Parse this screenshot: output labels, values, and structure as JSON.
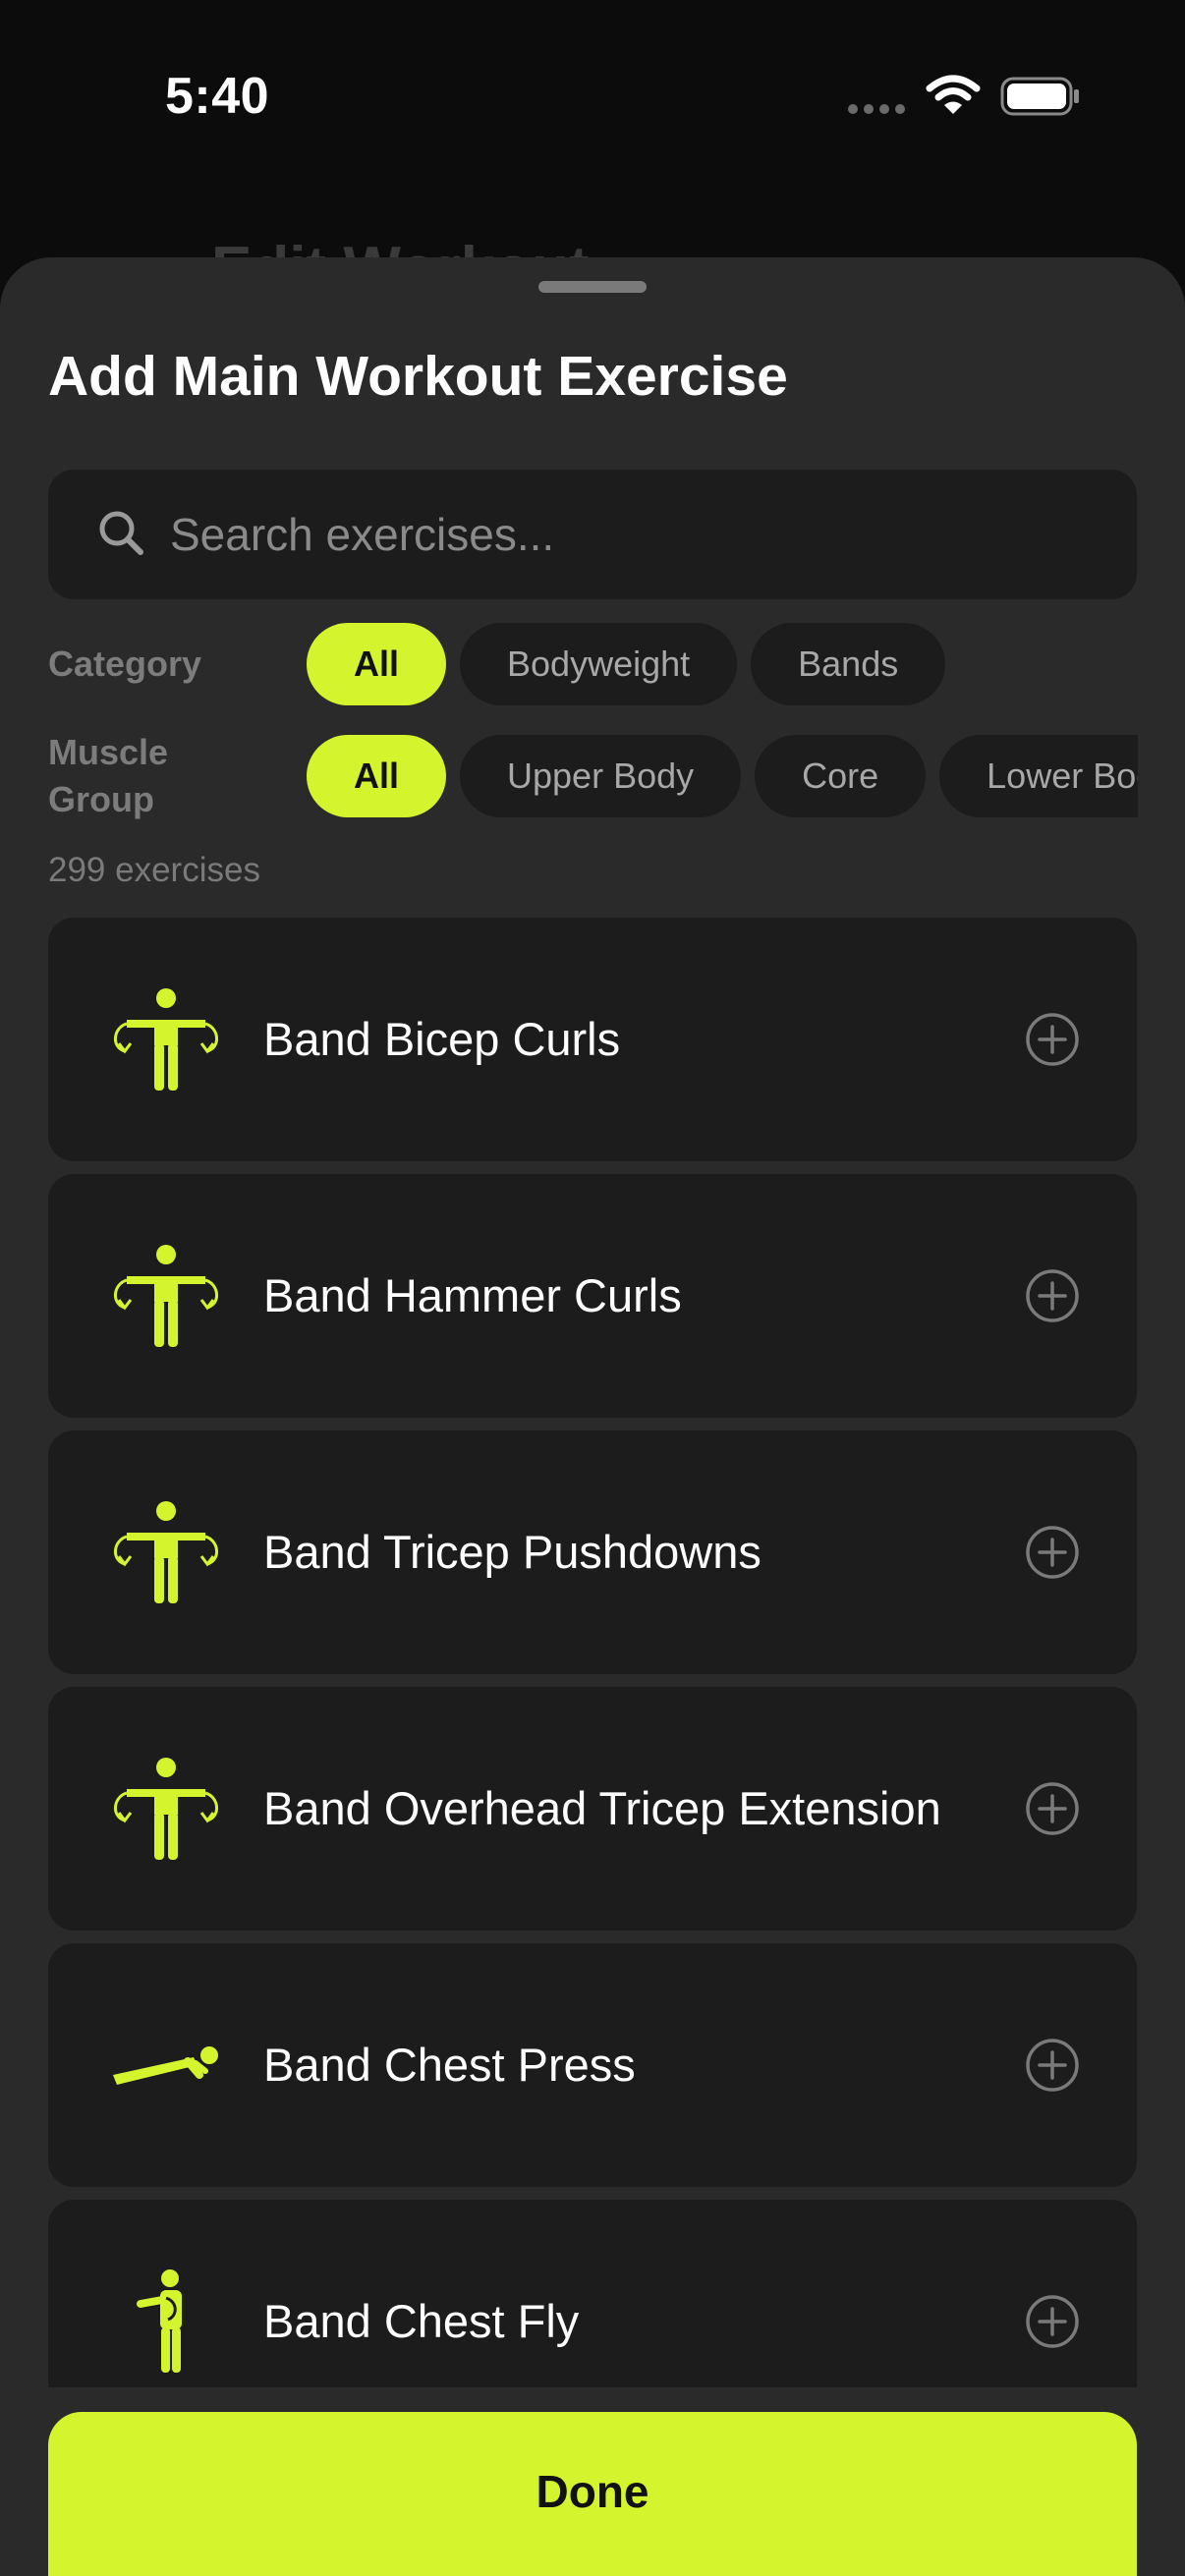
{
  "status_bar": {
    "time": "5:40"
  },
  "background_title": "Edit Workout",
  "sheet": {
    "title": "Add Main Workout Exercise",
    "search": {
      "placeholder": "Search exercises...",
      "value": ""
    },
    "filters": {
      "category": {
        "label": "Category",
        "options": [
          "All",
          "Bodyweight",
          "Bands"
        ],
        "selected": "All"
      },
      "muscle_group": {
        "label": "Muscle Group",
        "options": [
          "All",
          "Upper Body",
          "Core",
          "Lower Body"
        ],
        "selected": "All"
      }
    },
    "count_text": "299 exercises",
    "exercises": [
      {
        "name": "Band Bicep Curls",
        "icon": "figure-with-bands-icon"
      },
      {
        "name": "Band Hammer Curls",
        "icon": "figure-with-bands-icon"
      },
      {
        "name": "Band Tricep Pushdowns",
        "icon": "figure-with-bands-icon"
      },
      {
        "name": "Band Overhead Tricep Extension",
        "icon": "figure-with-bands-icon"
      },
      {
        "name": "Band Chest Press",
        "icon": "figure-pushup-icon"
      },
      {
        "name": "Band Chest Fly",
        "icon": "figure-side-arm-icon"
      }
    ],
    "done_label": "Done"
  },
  "colors": {
    "accent": "#d4f52e",
    "sheet_bg": "#2a2a2a",
    "card_bg": "#1c1c1c",
    "muted_text": "#7c7c7c"
  }
}
